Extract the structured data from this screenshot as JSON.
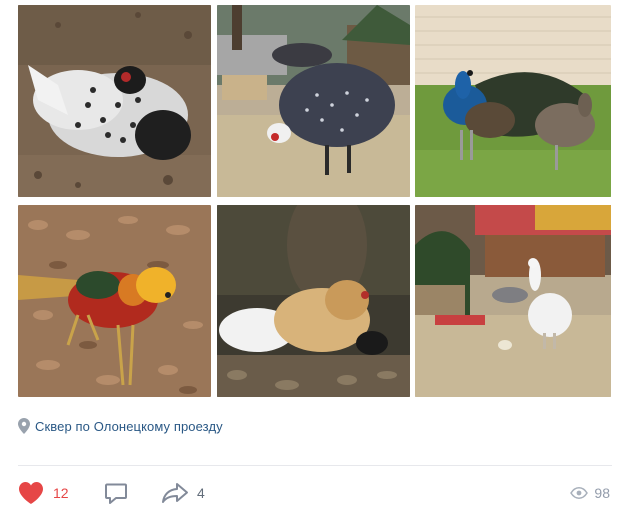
{
  "post": {
    "photos": [
      {
        "subject": "ornamental pheasant"
      },
      {
        "subject": "guineafowl"
      },
      {
        "subject": "peacocks"
      },
      {
        "subject": "golden pheasant"
      },
      {
        "subject": "silkie hens"
      },
      {
        "subject": "white peahen"
      }
    ],
    "location": {
      "icon": "location-pin-icon",
      "text": "Сквер по Олонецкому проезду"
    },
    "actions": {
      "likes": "12",
      "shares": "4",
      "views": "98",
      "like_color": "#e64646"
    }
  }
}
